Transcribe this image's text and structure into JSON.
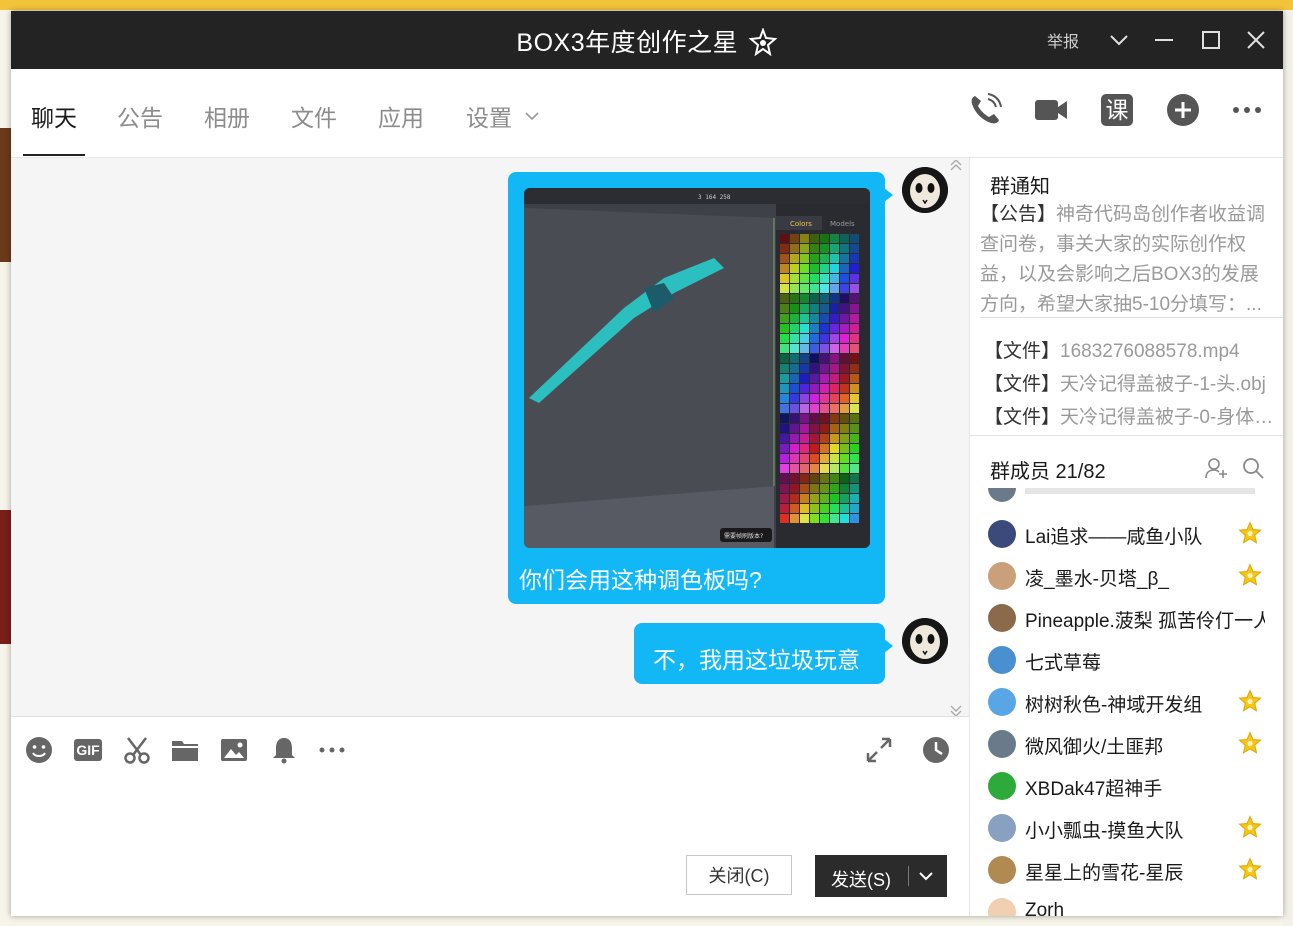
{
  "window": {
    "title": "BOX3年度创作之星",
    "report_label": "举报"
  },
  "tabs": [
    {
      "label": "聊天",
      "active": true
    },
    {
      "label": "公告"
    },
    {
      "label": "相册"
    },
    {
      "label": "文件"
    },
    {
      "label": "应用"
    },
    {
      "label": "设置"
    }
  ],
  "header_icons": [
    "phone-icon",
    "video-camera-icon",
    "course-icon",
    "add-circle-icon",
    "more-icon"
  ],
  "header_icon_texts": {
    "course": "课"
  },
  "messages": [
    {
      "type": "image",
      "caption": "你们会用这种调色板吗?",
      "image_panel_tabs": [
        "Colors",
        "Models"
      ],
      "image_top_text": "3  164  258",
      "image_bottom_text": "需要帧刷版本?"
    },
    {
      "type": "text",
      "text": "不，我用这垃圾玩意"
    }
  ],
  "toolbar_icons": [
    "emoji-icon",
    "gif-icon",
    "screenshot-scissors-icon",
    "folder-icon",
    "image-icon",
    "bell-icon",
    "more-icon",
    "expand-icon",
    "history-clock-icon"
  ],
  "toolbar_texts": {
    "gif": "GIF"
  },
  "buttons": {
    "close": "关闭(C)",
    "send": "发送(S)"
  },
  "sidebar": {
    "notice_title": "群通知",
    "notice_tag": "【公告】",
    "notice_text": "神奇代码岛创作者收益调查问卷，事关大家的实际创作权益，以及会影响之后BOX3的发展方向，希望大家抽5-10分填写：...",
    "files": [
      {
        "tag": "【文件】",
        "name": "1683276088578.mp4"
      },
      {
        "tag": "【文件】",
        "name": "天冷记得盖被子-1-头.obj"
      },
      {
        "tag": "【文件】",
        "name": "天冷记得盖被子-0-身体...."
      }
    ],
    "members_title": "群成员 21/82",
    "members": [
      {
        "name": "Lai追求——咸鱼小队",
        "star": true,
        "color": "#3b4a7a"
      },
      {
        "name": "凌_墨水-贝塔_β_",
        "star": true,
        "color": "#caa07a"
      },
      {
        "name": "Pineapple.菠梨 孤苦伶仃一人",
        "star": false,
        "color": "#8a6a4a"
      },
      {
        "name": "七式草莓",
        "star": false,
        "color": "#4a8fd0"
      },
      {
        "name": "树树秋色-神域开发组",
        "star": true,
        "color": "#58a6e6"
      },
      {
        "name": "微风御火/土匪邦",
        "star": true,
        "color": "#6a7a8a"
      },
      {
        "name": "XBDak47超神手",
        "star": false,
        "color": "#2eaa3a"
      },
      {
        "name": "小小瓢虫-摸鱼大队",
        "star": true,
        "color": "#8aa0c0"
      },
      {
        "name": "星星上的雪花-星辰",
        "star": true,
        "color": "#b08a50"
      },
      {
        "name": "Zorh",
        "star": false,
        "color": "#f0d0b0"
      }
    ]
  }
}
